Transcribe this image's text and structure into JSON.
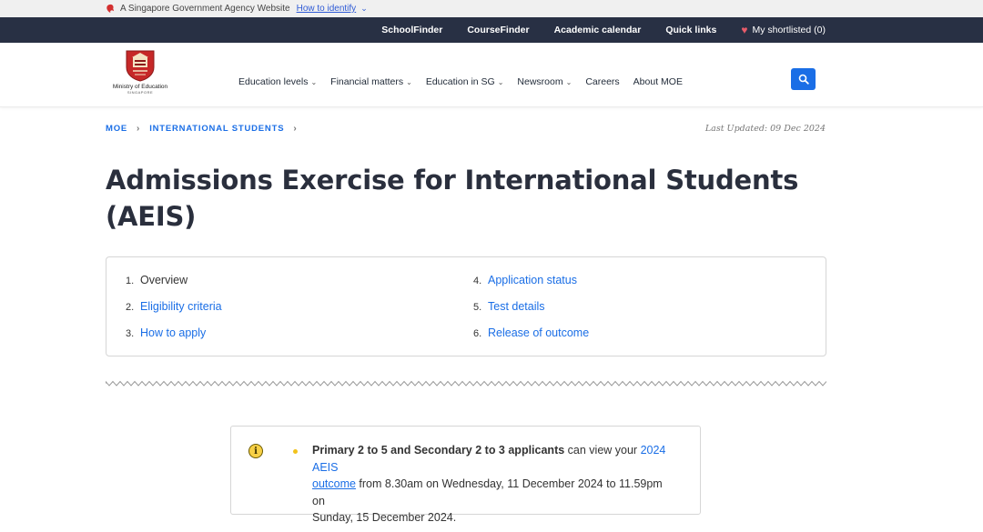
{
  "masthead": {
    "text": "A Singapore Government Agency Website",
    "identify_link": "How to identify"
  },
  "utility_bar": {
    "links": [
      "SchoolFinder",
      "CourseFinder",
      "Academic calendar",
      "Quick links"
    ],
    "shortlist": "My shortlisted (0)"
  },
  "logo": {
    "line1": "Ministry of Education",
    "line2": "SINGAPORE"
  },
  "nav": {
    "items": [
      {
        "label": "Education levels",
        "dropdown": true
      },
      {
        "label": "Financial matters",
        "dropdown": true
      },
      {
        "label": "Education in SG",
        "dropdown": true
      },
      {
        "label": "Newsroom",
        "dropdown": true
      },
      {
        "label": "Careers",
        "dropdown": false
      },
      {
        "label": "About MOE",
        "dropdown": false
      }
    ],
    "search_icon": "search-icon"
  },
  "breadcrumb": {
    "items": [
      "MOE",
      "INTERNATIONAL STUDENTS"
    ],
    "last_updated": "Last Updated: 09 Dec 2024"
  },
  "page": {
    "title": "Admissions Exercise for International Students (AEIS)"
  },
  "toc": [
    {
      "num": "1.",
      "label": "Overview",
      "active": true
    },
    {
      "num": "2.",
      "label": "Eligibility criteria",
      "active": false
    },
    {
      "num": "3.",
      "label": "How to apply",
      "active": false
    },
    {
      "num": "4.",
      "label": "Application status",
      "active": false
    },
    {
      "num": "5.",
      "label": "Test details",
      "active": false
    },
    {
      "num": "6.",
      "label": "Release of outcome",
      "active": false
    }
  ],
  "notice": {
    "bold": "Primary 2 to 5 and Secondary 2 to 3 applicants",
    "mid": " can view your ",
    "link_a": "2024 AEIS",
    "link_b": "outcome",
    "rest_a": " from 8.30am on Wednesday, 11 December 2024 to 11.59pm on",
    "rest_b": "Sunday, 15 December 2024."
  },
  "colors": {
    "accent": "#1a6ee6",
    "dark_bar": "#283044",
    "heart": "#e85c6a",
    "info_yellow": "#f7d046"
  }
}
